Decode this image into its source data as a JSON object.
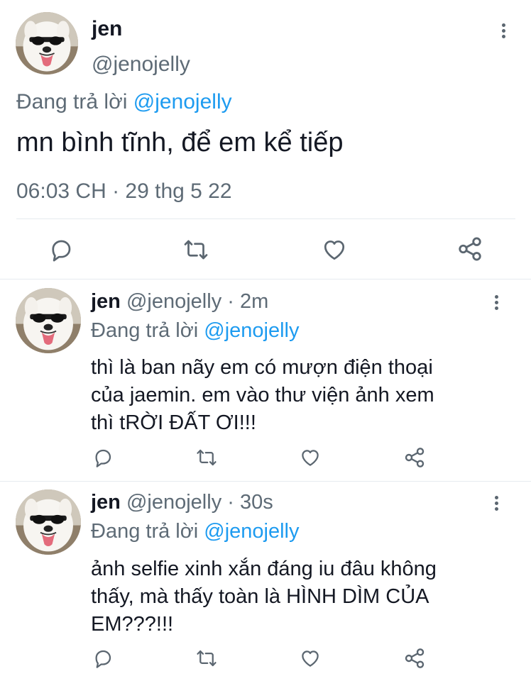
{
  "main_tweet": {
    "display_name": "jen",
    "handle": "@jenojelly",
    "reply_prefix": "Đang trả lời",
    "reply_to": "@jenojelly",
    "text": "mn bình tĩnh, để em kể tiếp",
    "timestamp": "06:03 CH · 29 thg 5 22"
  },
  "replies": [
    {
      "display_name": "jen",
      "handle_time": "@jenojelly · 2m",
      "reply_prefix": "Đang trả lời",
      "reply_to": "@jenojelly",
      "text_lines": [
        "thì là ban nãy em có mượn điện thoại",
        "của jaemin. em vào thư viện ảnh xem",
        "thì tRỜI ĐẤT ƠI!!!"
      ]
    },
    {
      "display_name": "jen",
      "handle_time": "@jenojelly · 30s",
      "reply_prefix": "Đang trả lời",
      "reply_to": "@jenojelly",
      "text_lines": [
        "ảnh selfie xinh xắn đáng iu đâu không",
        "thấy, mà thấy toàn là HÌNH DÌM CỦA",
        "EM???!!!"
      ]
    }
  ],
  "icons": [
    "comment-icon",
    "retweet-icon",
    "like-icon",
    "share-icon",
    "more-icon"
  ],
  "colors": {
    "accent": "#1d9bf0",
    "muted": "#5e6b76",
    "text": "#141823"
  }
}
